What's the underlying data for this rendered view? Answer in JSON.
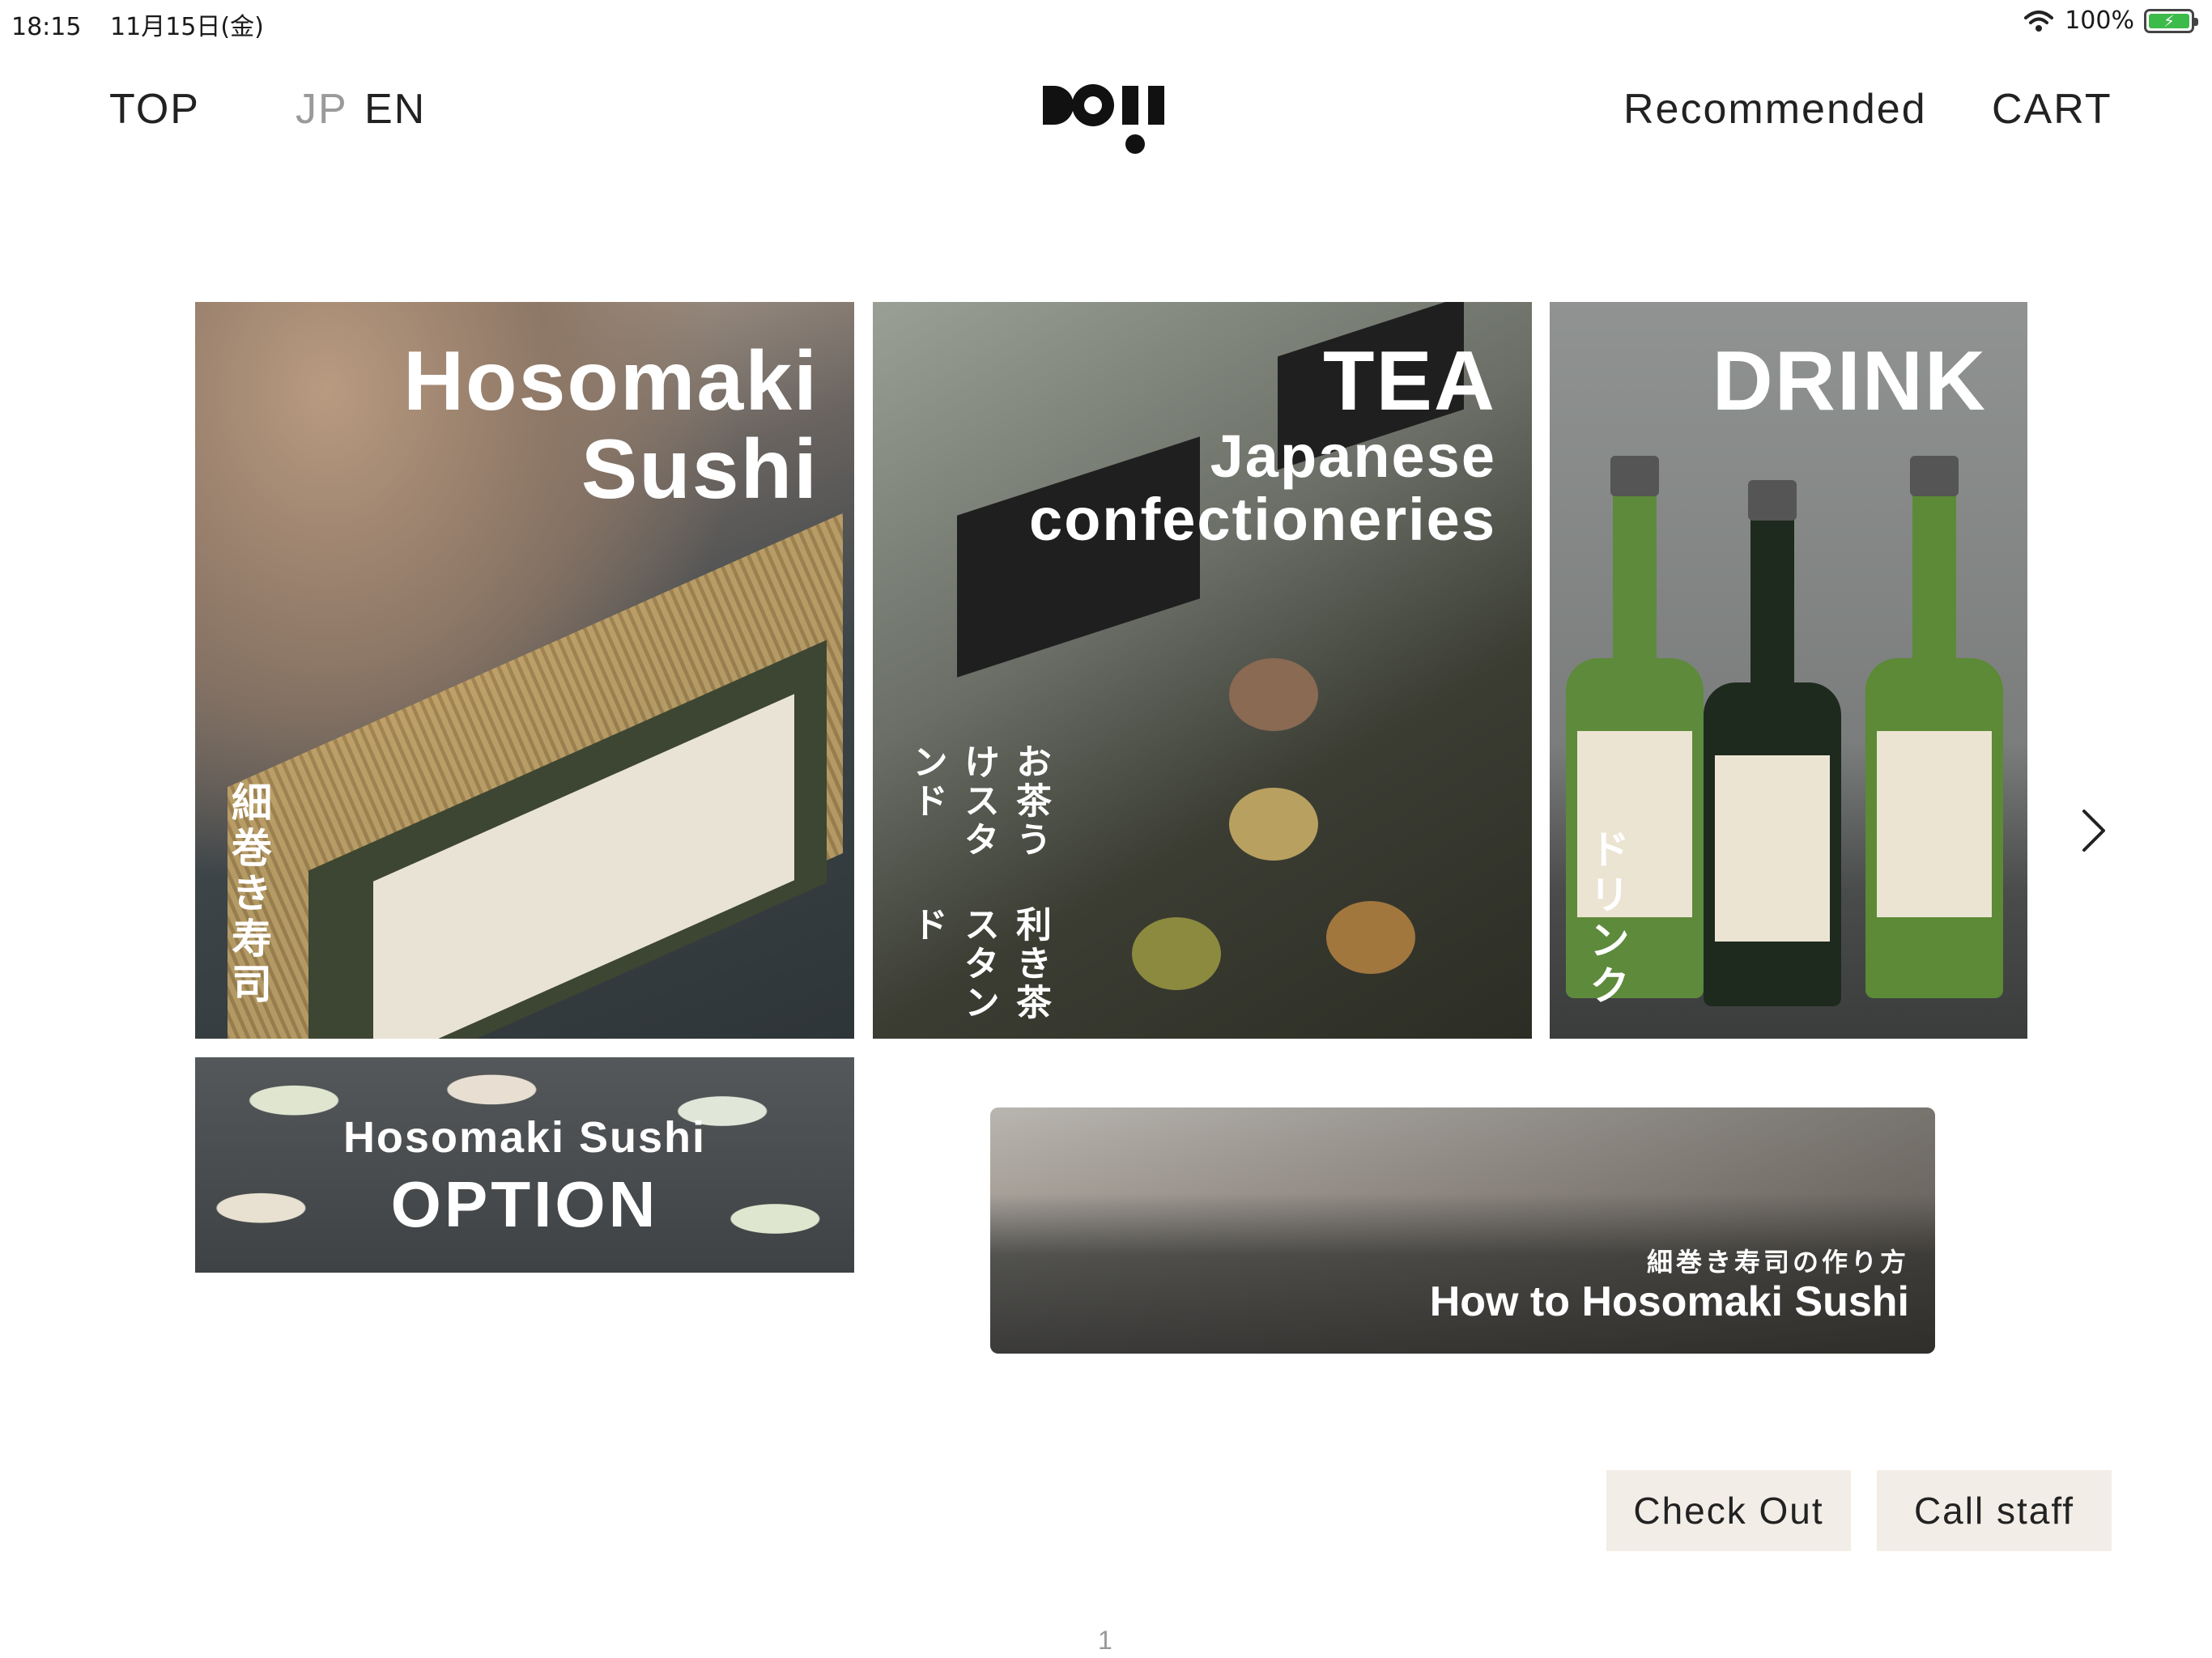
{
  "status_bar": {
    "time": "18:15",
    "date": "11月15日(金)",
    "battery": "100%"
  },
  "header": {
    "top_link": "TOP",
    "lang_jp": "JP",
    "lang_en": "EN",
    "recommended": "Recommended",
    "cart": "CART"
  },
  "tiles": {
    "sushi": {
      "title_line1": "Hosomaki",
      "title_line2": "Sushi",
      "jp": "細巻き寿司"
    },
    "tea": {
      "title": "TEA",
      "subtitle_line1": "Japanese",
      "subtitle_line2": "confectioneries",
      "jp_line1": "利き茶スタンド",
      "jp_line2": "お茶うけスタンド"
    },
    "drink": {
      "title": "DRINK",
      "jp": "ドリンク"
    },
    "option": {
      "sub": "Hosomaki Sushi",
      "main": "OPTION"
    },
    "howto": {
      "jp": "細巻き寿司の作り方",
      "en": "How to Hosomaki Sushi"
    }
  },
  "actions": {
    "checkout": "Check Out",
    "call_staff": "Call staff"
  },
  "pagination": {
    "current": "1"
  },
  "colors": {
    "button_bg": "#f3ede7",
    "lang_inactive": "#9a9a9a"
  },
  "icons": [
    "wifi-icon",
    "battery-icon",
    "logo-icon",
    "chevron-right-icon"
  ]
}
